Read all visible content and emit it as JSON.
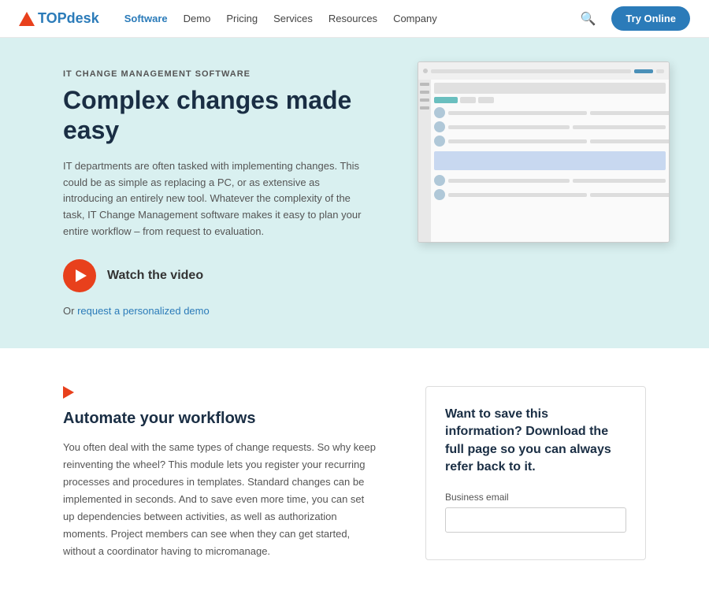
{
  "nav": {
    "logo_text": "TOPdesk",
    "links": [
      {
        "label": "Software",
        "active": true
      },
      {
        "label": "Demo",
        "active": false
      },
      {
        "label": "Pricing",
        "active": false
      },
      {
        "label": "Services",
        "active": false
      },
      {
        "label": "Resources",
        "active": false
      },
      {
        "label": "Company",
        "active": false
      }
    ],
    "cta_label": "Try Online"
  },
  "hero": {
    "label": "IT CHANGE MANAGEMENT SOFTWARE",
    "title": "Complex changes made easy",
    "description": "IT departments are often tasked with implementing changes. This could be as simple as replacing a PC, or as extensive as introducing an entirely new tool. Whatever the complexity of the task, IT Change Management software makes it easy to plan your entire workflow – from request to evaluation.",
    "watch_label": "Watch the video",
    "demo_prefix": "Or ",
    "demo_link_text": "request a personalized demo"
  },
  "section": {
    "title": "Automate your workflows",
    "description": "You often deal with the same types of change requests. So why keep reinventing the wheel? This module lets you register your recurring processes and procedures in templates. Standard changes can be implemented in seconds. And to save even more time, you can set up dependencies between activities, as well as authorization moments. Project members can see when they can get started, without a coordinator having to micromanage."
  },
  "card": {
    "title": "Want to save this information? Download the full page so you can always refer back to it.",
    "form_label": "Business email",
    "form_placeholder": ""
  }
}
